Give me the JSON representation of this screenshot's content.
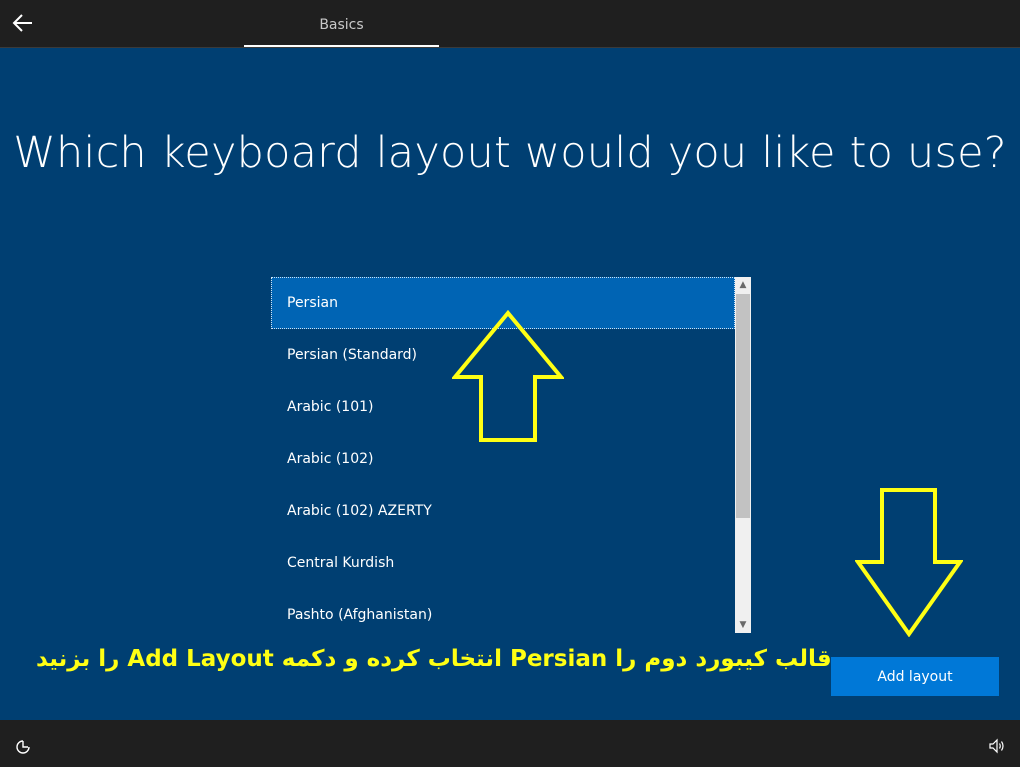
{
  "header": {
    "back_icon": "back-arrow-icon",
    "tab_label": "Basics"
  },
  "main": {
    "title": "Which keyboard layout would you like to use?",
    "layouts": [
      {
        "label": "Persian",
        "selected": true
      },
      {
        "label": "Persian (Standard)",
        "selected": false
      },
      {
        "label": "Arabic (101)",
        "selected": false
      },
      {
        "label": "Arabic (102)",
        "selected": false
      },
      {
        "label": "Arabic (102) AZERTY",
        "selected": false
      },
      {
        "label": "Central Kurdish",
        "selected": false
      },
      {
        "label": "Pashto (Afghanistan)",
        "selected": false
      }
    ],
    "add_layout_label": "Add layout"
  },
  "annotation": {
    "text": "قالب کیبورد دوم را Persian انتخاب کرده و دکمه Add Layout را بزنید",
    "color": "#ffff14"
  },
  "footer": {
    "ease_of_access_icon": "ease-of-access-icon",
    "volume_icon": "volume-icon"
  },
  "colors": {
    "background": "#003f72",
    "selected": "#0064b4",
    "accent": "#0078d7"
  }
}
